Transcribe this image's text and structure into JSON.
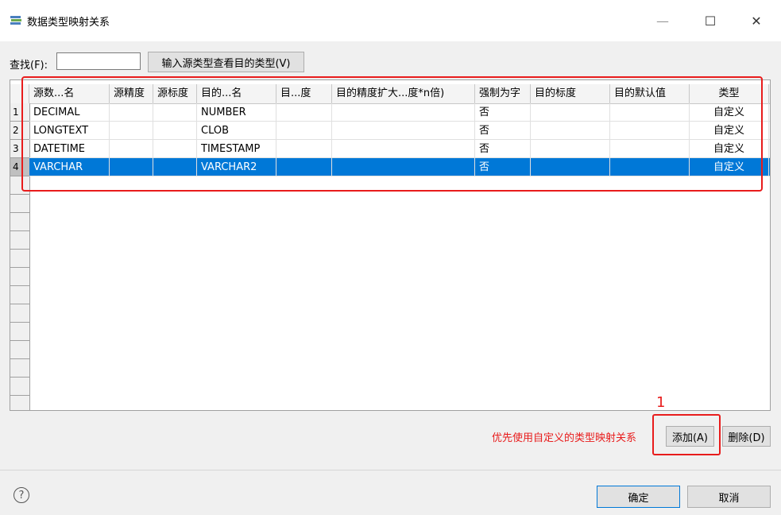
{
  "window": {
    "title": "数据类型映射关系",
    "icon": "stack-layers-icon",
    "minimize_glyph": "—",
    "maximize_glyph": "☐",
    "close_glyph": "✕"
  },
  "toolbar": {
    "find_label": "查找(F):",
    "find_value": "",
    "lookup_button": "输入源类型查看目的类型(V)"
  },
  "grid": {
    "columns": [
      "源数...名",
      "源精度",
      "源标度",
      "目的...名",
      "目...度",
      "目的精度扩大...度*n倍)",
      "强制为字",
      "目的标度",
      "目的默认值",
      "类型"
    ],
    "rows": [
      {
        "num": "1",
        "cells": [
          "DECIMAL",
          "",
          "",
          "NUMBER",
          "",
          "",
          "否",
          "",
          "",
          "自定义"
        ]
      },
      {
        "num": "2",
        "cells": [
          "LONGTEXT",
          "",
          "",
          "CLOB",
          "",
          "",
          "否",
          "",
          "",
          "自定义"
        ]
      },
      {
        "num": "3",
        "cells": [
          "DATETIME",
          "",
          "",
          "TIMESTAMP",
          "",
          "",
          "否",
          "",
          "",
          "自定义"
        ]
      },
      {
        "num": "4",
        "cells": [
          "VARCHAR",
          "",
          "",
          "VARCHAR2",
          "",
          "",
          "否",
          "",
          "",
          "自定义"
        ]
      }
    ],
    "selected_row_color": "#0078d7"
  },
  "annotation": {
    "number": "1",
    "color": "#e81c1c"
  },
  "actions": {
    "hint": "优先使用自定义的类型映射关系",
    "add_button": "添加(A)",
    "delete_button": "删除(D)"
  },
  "footer": {
    "help_glyph": "?",
    "ok_button": "确定",
    "cancel_button": "取消"
  }
}
